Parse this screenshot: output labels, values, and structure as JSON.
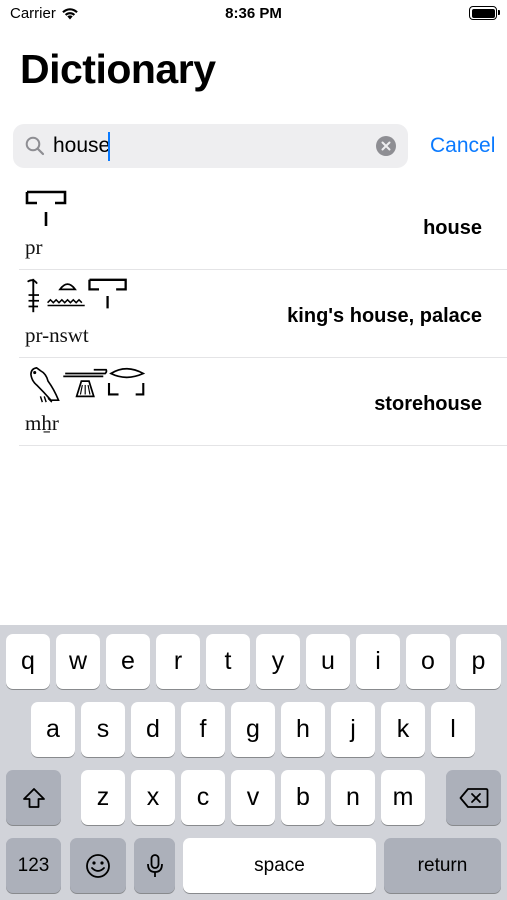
{
  "status_bar": {
    "carrier": "Carrier",
    "time": "8:36 PM",
    "battery_level": 1.0
  },
  "page_title": "Dictionary",
  "search": {
    "value": "house",
    "cancel_label": "Cancel"
  },
  "results": [
    {
      "transliteration": "pr",
      "meaning": "house",
      "glyph_icon": "pr-house-glyph"
    },
    {
      "transliteration": "pr-nswt",
      "meaning": "king's house, palace",
      "glyph_icon": "pr-nswt-glyphs"
    },
    {
      "transliteration": "mẖr",
      "meaning": "storehouse",
      "glyph_icon": "mhr-glyphs"
    }
  ],
  "keyboard": {
    "row1": [
      "q",
      "w",
      "e",
      "r",
      "t",
      "y",
      "u",
      "i",
      "o",
      "p"
    ],
    "row2": [
      "a",
      "s",
      "d",
      "f",
      "g",
      "h",
      "j",
      "k",
      "l"
    ],
    "row3": [
      "z",
      "x",
      "c",
      "v",
      "b",
      "n",
      "m"
    ],
    "numbers_label": "123",
    "space_label": "space",
    "return_label": "return",
    "icons": {
      "shift": "shift-icon",
      "delete": "delete-icon",
      "emoji": "emoji-icon",
      "mic": "mic-icon"
    }
  }
}
